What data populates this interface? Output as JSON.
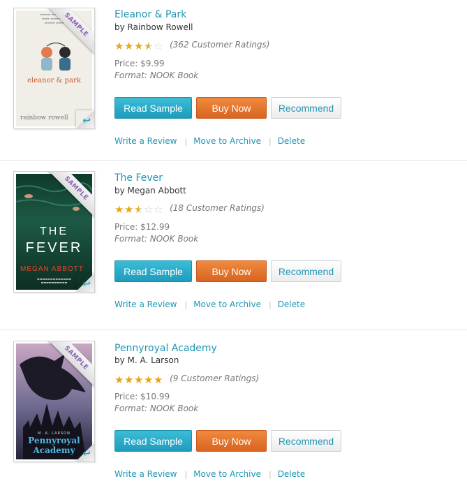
{
  "books": [
    {
      "title": "Eleanor & Park",
      "author": "by Rainbow Rowell",
      "stars": 3.5,
      "ratings_text": "(362 Customer Ratings)",
      "price": "Price: $9.99",
      "format": "Format: NOOK Book",
      "cover_title": "eleanor & park",
      "cover_author": "rainbow rowell",
      "cover_icon": "two-teens-with-headphones-illustration"
    },
    {
      "title": "The Fever",
      "author": "by Megan Abbott",
      "stars": 2.5,
      "ratings_text": "(18 Customer Ratings)",
      "price": "Price: $12.99",
      "format": "Format: NOOK Book",
      "cover_title_1": "THE",
      "cover_title_2": "FEVER",
      "cover_author": "MEGAN ABBOTT",
      "cover_icon": "swimmers-in-green-water-photo"
    },
    {
      "title": "Pennyroyal Academy",
      "author": "by M. A. Larson",
      "stars": 5,
      "ratings_text": "(9 Customer Ratings)",
      "price": "Price: $10.99",
      "format": "Format: NOOK Book",
      "cover_author": "M. A. LARSON",
      "cover_title_1": "Pennyroyal",
      "cover_title_2": "Academy",
      "cover_icon": "dragon-over-castle-illustration"
    }
  ],
  "ribbon_label": "SAMPLE",
  "buttons": {
    "read_sample": "Read Sample",
    "buy_now": "Buy Now",
    "recommend": "Recommend"
  },
  "links": {
    "write_review": "Write a Review",
    "move_archive": "Move to Archive",
    "delete": "Delete",
    "separator": "|"
  },
  "colors": {
    "link": "#1f95b5",
    "read_button": "#25a9c8",
    "buy_button": "#e4732c",
    "star": "#e6a818",
    "ribbon_text": "#8b61b5"
  }
}
